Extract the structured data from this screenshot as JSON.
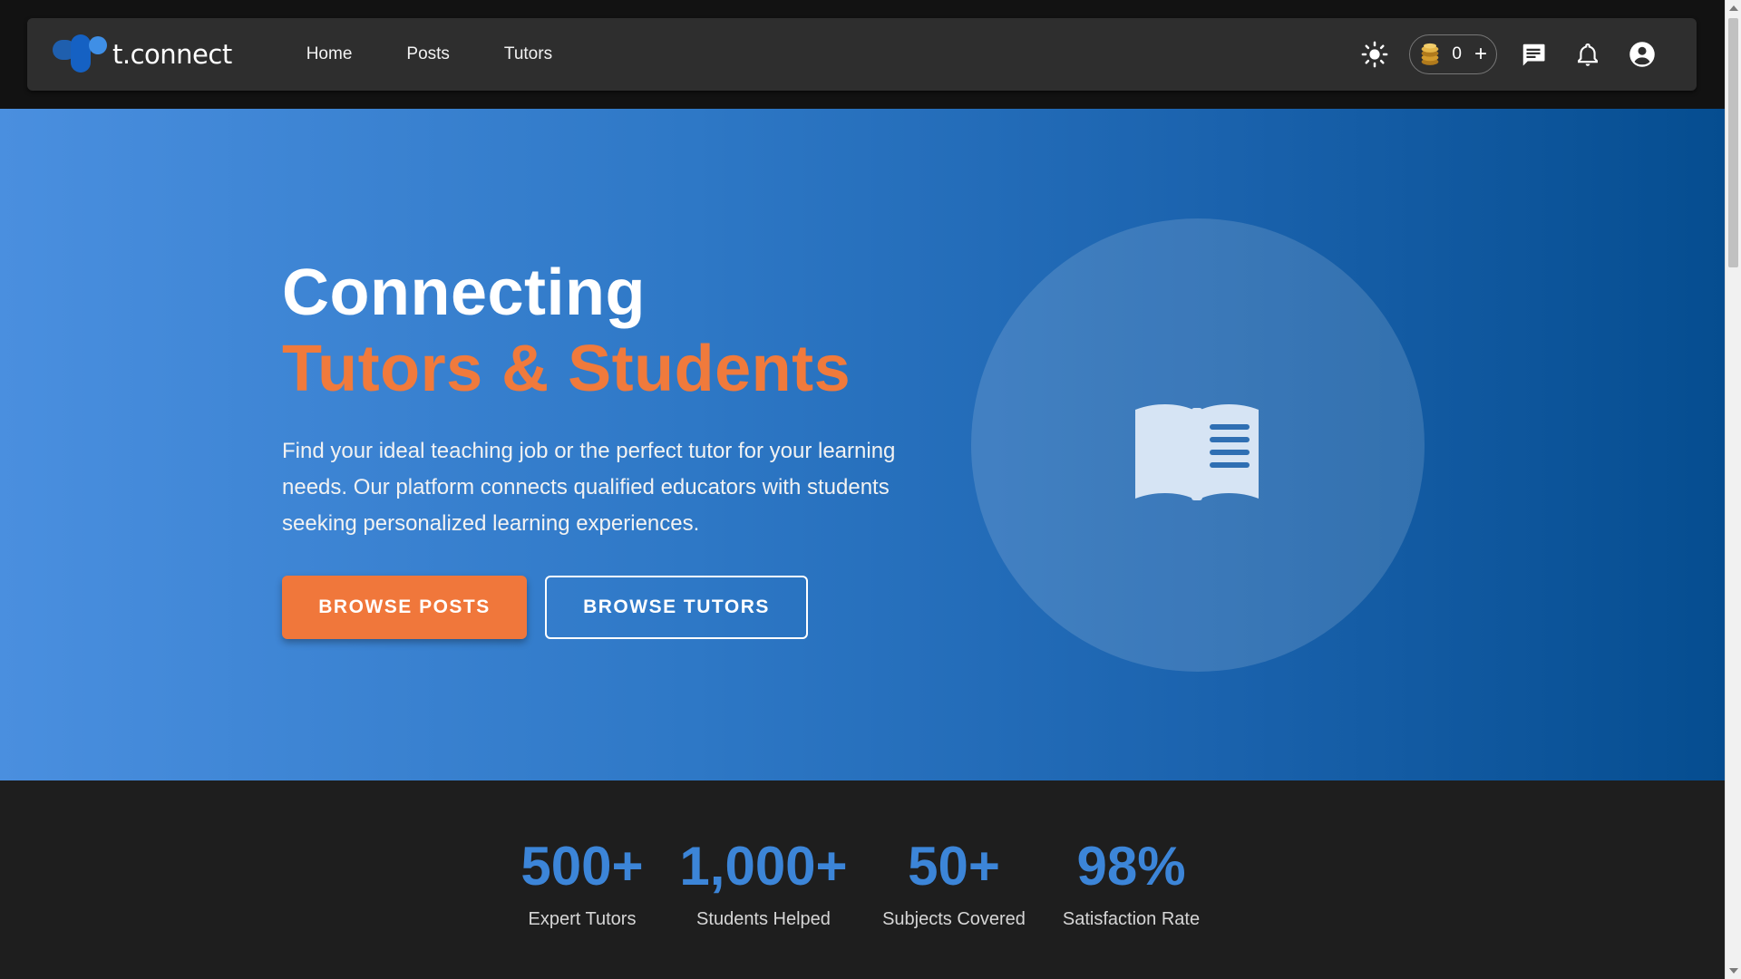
{
  "brand": {
    "name": "t.connect"
  },
  "nav": {
    "links": [
      "Home",
      "Posts",
      "Tutors"
    ],
    "coin_count": "0",
    "add_symbol": "+"
  },
  "hero": {
    "title_line1": "Connecting",
    "title_line2": "Tutors & Students",
    "description": "Find your ideal teaching job or the perfect tutor for your learning needs. Our platform connects qualified educators with students seeking personalized learning experiences.",
    "primary_button": "BROWSE POSTS",
    "secondary_button": "BROWSE TUTORS",
    "illustration_icon": "open-book-icon"
  },
  "stats": [
    {
      "value": "500+",
      "label": "Expert Tutors"
    },
    {
      "value": "1,000+",
      "label": "Students Helped"
    },
    {
      "value": "50+",
      "label": "Subjects Covered"
    },
    {
      "value": "98%",
      "label": "Satisfaction Rate"
    }
  ],
  "colors": {
    "accent_orange": "#f0773b",
    "stat_blue": "#3c85d8",
    "navbar_bg": "#2e2e2e",
    "page_bg": "#121212"
  },
  "icons": [
    "sun-icon",
    "coin-icon",
    "chat-icon",
    "bell-icon",
    "account-icon"
  ]
}
